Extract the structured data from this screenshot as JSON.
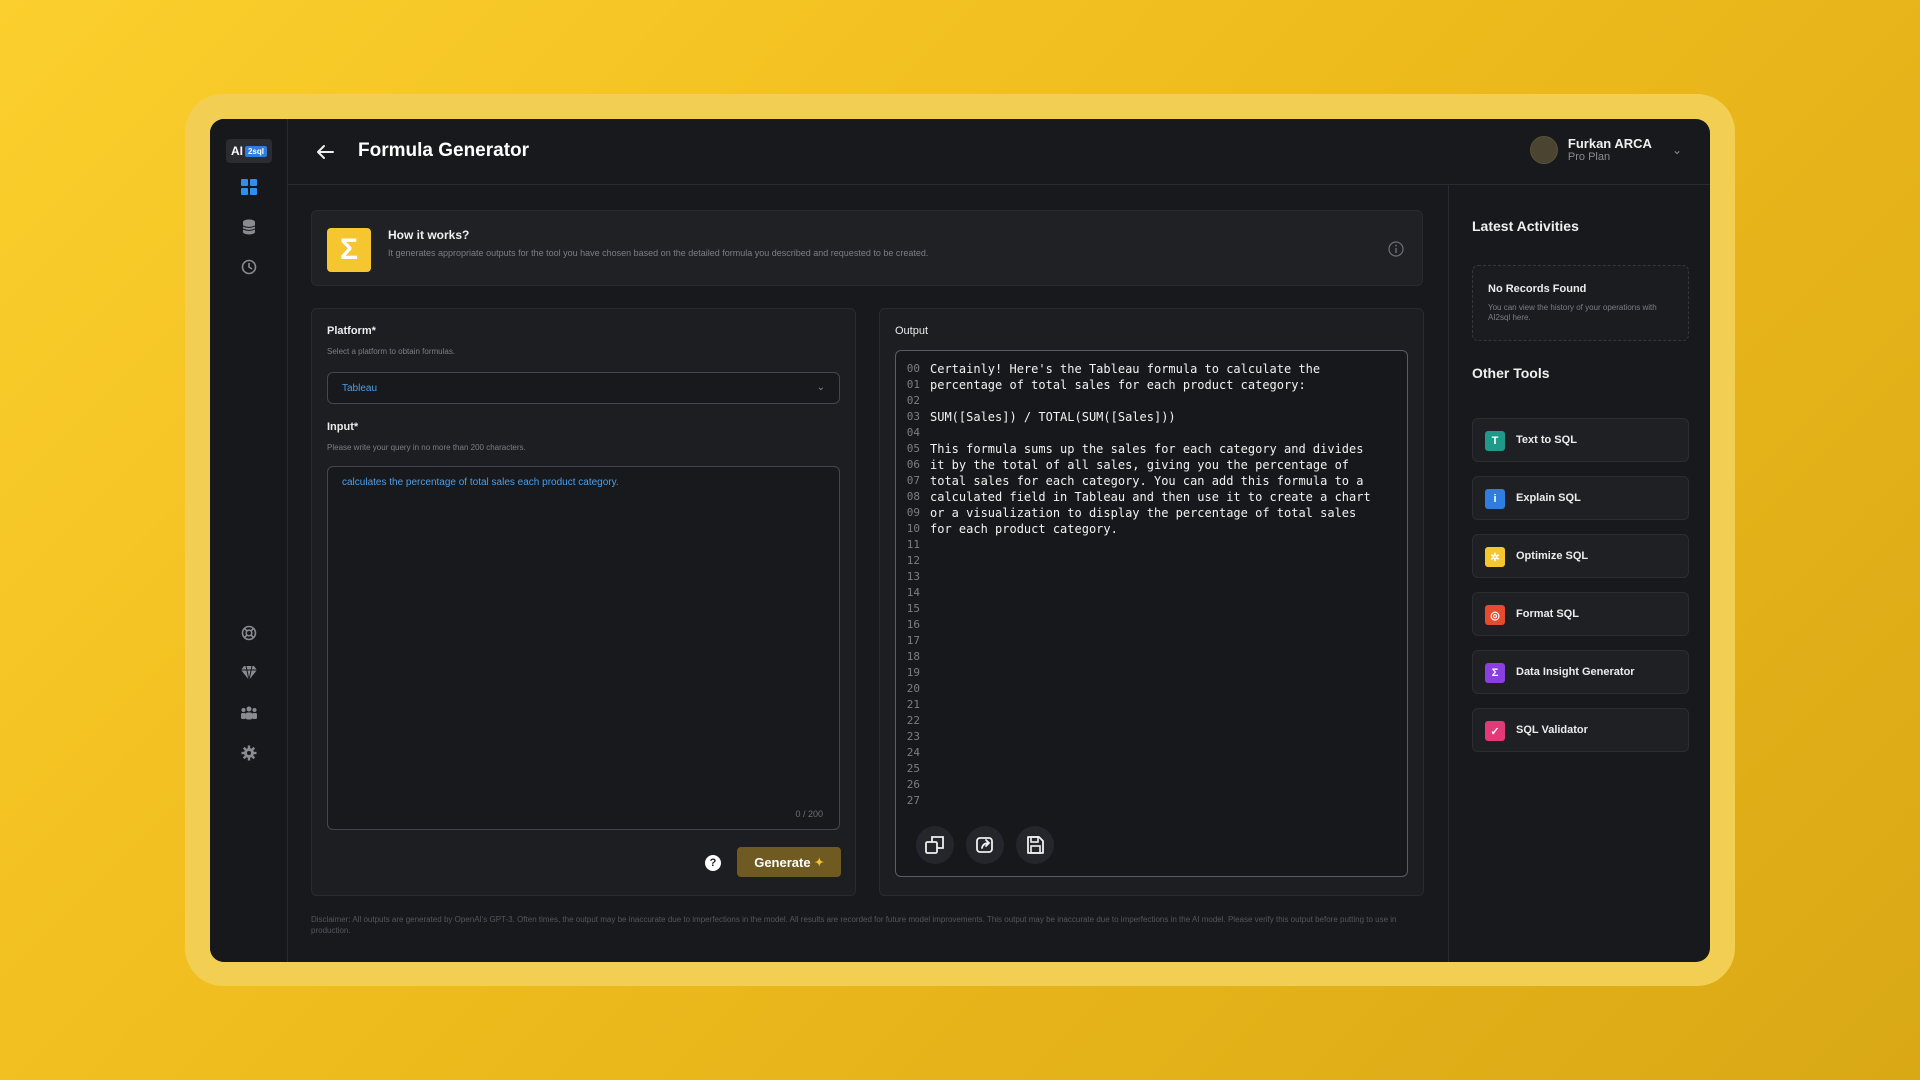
{
  "logo": {
    "text": "AI",
    "badge": "2sql"
  },
  "header": {
    "title": "Formula Generator",
    "user_name": "Furkan ARCA",
    "user_plan": "Pro Plan"
  },
  "how_it_works": {
    "title": "How it works?",
    "description": "It generates appropriate outputs for the tool you have chosen based on the detailed formula you described and requested to be created."
  },
  "form": {
    "platform_label": "Platform*",
    "platform_hint": "Select a platform to obtain formulas.",
    "platform_value": "Tableau",
    "input_label": "Input*",
    "input_hint": "Please write your query in no more than 200 characters.",
    "input_value": "calculates the percentage of total sales each product category.",
    "counter": "0 / 200",
    "help": "?",
    "generate_label": "Generate"
  },
  "output": {
    "label": "Output",
    "lines": [
      {
        "n": "00",
        "t": "Certainly! Here's the Tableau formula to calculate the"
      },
      {
        "n": "01",
        "t": "percentage of total sales for each product category:"
      },
      {
        "n": "02",
        "t": ""
      },
      {
        "n": "03",
        "t": "SUM([Sales]) / TOTAL(SUM([Sales]))"
      },
      {
        "n": "04",
        "t": ""
      },
      {
        "n": "05",
        "t": "This formula sums up the sales for each category and divides"
      },
      {
        "n": "06",
        "t": "it by the total of all sales, giving you the percentage of"
      },
      {
        "n": "07",
        "t": "total sales for each category. You can add this formula to a"
      },
      {
        "n": "08",
        "t": "calculated field in Tableau and then use it to create a chart"
      },
      {
        "n": "09",
        "t": "or a visualization to display the percentage of total sales"
      },
      {
        "n": "10",
        "t": "for each product category."
      },
      {
        "n": "11",
        "t": ""
      },
      {
        "n": "12",
        "t": ""
      },
      {
        "n": "13",
        "t": ""
      },
      {
        "n": "14",
        "t": ""
      },
      {
        "n": "15",
        "t": ""
      },
      {
        "n": "16",
        "t": ""
      },
      {
        "n": "17",
        "t": ""
      },
      {
        "n": "18",
        "t": ""
      },
      {
        "n": "19",
        "t": ""
      },
      {
        "n": "20",
        "t": ""
      },
      {
        "n": "21",
        "t": ""
      },
      {
        "n": "22",
        "t": ""
      },
      {
        "n": "23",
        "t": ""
      },
      {
        "n": "24",
        "t": ""
      },
      {
        "n": "25",
        "t": ""
      },
      {
        "n": "26",
        "t": ""
      },
      {
        "n": "27",
        "t": ""
      }
    ]
  },
  "disclaimer": "Disclaimer: All outputs are generated by OpenAI's GPT-3. Often times, the output may be inaccurate due to imperfections in the model. All results are recorded for future model improvements. This output may be inaccurate due to imperfections in the AI model. Please verify this output before putting to use in production.",
  "activities": {
    "title": "Latest Activities",
    "empty_title": "No Records Found",
    "empty_desc": "You can view the history of your operations with AI2sql here."
  },
  "other_tools": {
    "title": "Other Tools",
    "items": [
      {
        "label": "Text to SQL",
        "color": "#1f9a8a",
        "glyph": "T"
      },
      {
        "label": "Explain SQL",
        "color": "#2f7de1",
        "glyph": "i"
      },
      {
        "label": "Optimize SQL",
        "color": "#f5c630",
        "glyph": "✲"
      },
      {
        "label": "Format SQL",
        "color": "#e8492f",
        "glyph": "◎"
      },
      {
        "label": "Data Insight Generator",
        "color": "#8b3fe0",
        "glyph": "Σ"
      },
      {
        "label": "SQL Validator",
        "color": "#e23a78",
        "glyph": "✓"
      }
    ]
  },
  "icons": [
    "dashboard-icon",
    "database-icon",
    "history-icon",
    "support-icon",
    "diamond-icon",
    "team-icon",
    "settings-icon"
  ]
}
